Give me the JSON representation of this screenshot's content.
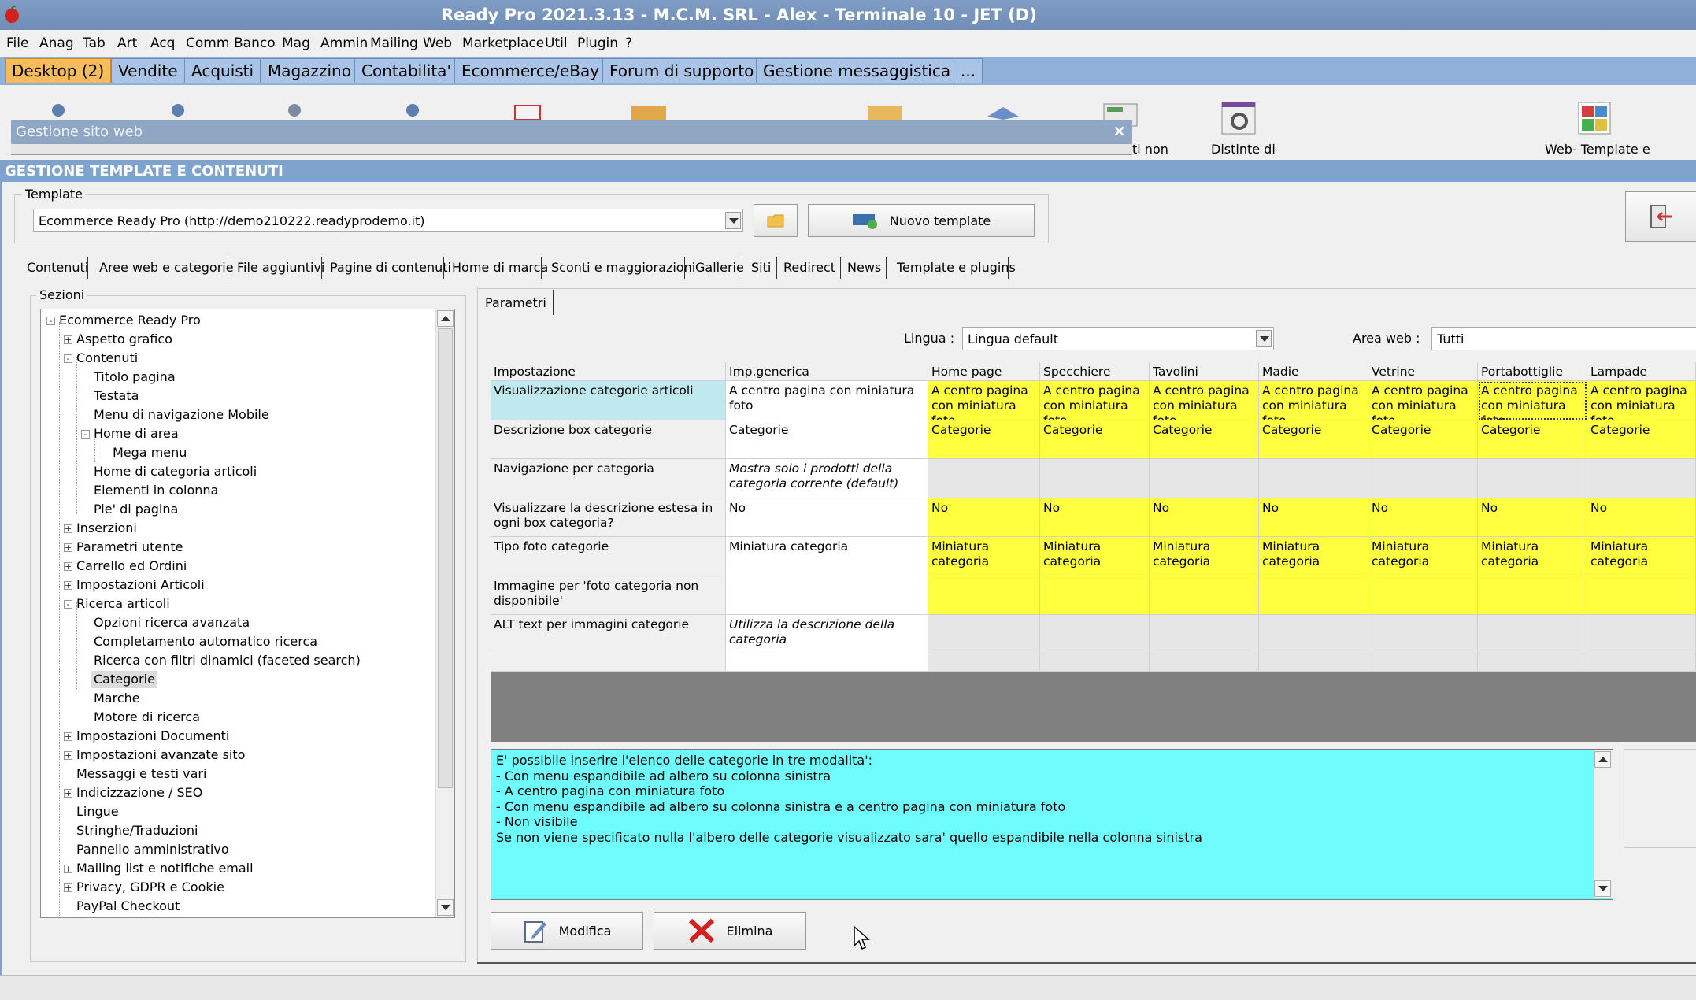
{
  "window": {
    "title": "Ready Pro 2021.3.13 - M.C.M. SRL - Alex - Terminale 10 - JET (D)"
  },
  "menubar": [
    "File",
    "Anag",
    "Tab",
    "Art",
    "Acq",
    "Comm",
    "Banco",
    "Mag",
    "Ammin",
    "Mailing",
    "Web",
    "Marketplace",
    "Util",
    "Plugin",
    "?"
  ],
  "main_tabs": [
    "Desktop (2)",
    "Vendite",
    "Acquisti",
    "Magazzino",
    "Contabilita'",
    "Ecommerce/eBay",
    "Forum di supporto",
    "Gestione messaggistica",
    "..."
  ],
  "toolbar": {
    "label_partial": "ti non",
    "label_distinte": "Distinte di",
    "label_web": "Web- Template e"
  },
  "subwindow": {
    "title": "Gestione sito web"
  },
  "panel": {
    "header": "GESTIONE TEMPLATE E CONTENUTI",
    "template_label": "Template",
    "template_value": "Ecommerce Ready Pro (http://demo210222.readyprodemo.it)",
    "new_template_button": "Nuovo template"
  },
  "content_tabs": [
    "Contenuti",
    "Aree web e categorie",
    "File aggiuntivi",
    "Pagine di contenuti",
    "Home di marca",
    "Sconti e maggiorazioni",
    "Gallerie",
    "Siti",
    "Redirect",
    "News",
    "Template e plugins"
  ],
  "sections": {
    "label": "Sezioni",
    "tree": [
      {
        "label": "Ecommerce Ready Pro",
        "level": 0,
        "toggle": "-"
      },
      {
        "label": "Aspetto grafico",
        "level": 1,
        "toggle": "+"
      },
      {
        "label": "Contenuti",
        "level": 1,
        "toggle": "-"
      },
      {
        "label": "Titolo pagina",
        "level": 2,
        "toggle": ""
      },
      {
        "label": "Testata",
        "level": 2,
        "toggle": ""
      },
      {
        "label": "Menu di navigazione Mobile",
        "level": 2,
        "toggle": ""
      },
      {
        "label": "Home di area",
        "level": 2,
        "toggle": "-"
      },
      {
        "label": "Mega menu",
        "level": 3,
        "toggle": ""
      },
      {
        "label": "Home di categoria articoli",
        "level": 2,
        "toggle": ""
      },
      {
        "label": "Elementi in colonna",
        "level": 2,
        "toggle": ""
      },
      {
        "label": "Pie' di pagina",
        "level": 2,
        "toggle": ""
      },
      {
        "label": "Inserzioni",
        "level": 1,
        "toggle": "+"
      },
      {
        "label": "Parametri utente",
        "level": 1,
        "toggle": "+"
      },
      {
        "label": "Carrello ed Ordini",
        "level": 1,
        "toggle": "+"
      },
      {
        "label": "Impostazioni Articoli",
        "level": 1,
        "toggle": "+"
      },
      {
        "label": "Ricerca articoli",
        "level": 1,
        "toggle": "-"
      },
      {
        "label": "Opzioni ricerca avanzata",
        "level": 2,
        "toggle": ""
      },
      {
        "label": "Completamento automatico ricerca",
        "level": 2,
        "toggle": ""
      },
      {
        "label": "Ricerca con filtri dinamici (faceted search)",
        "level": 2,
        "toggle": ""
      },
      {
        "label": "Categorie",
        "level": 2,
        "toggle": "",
        "selected": true
      },
      {
        "label": "Marche",
        "level": 2,
        "toggle": ""
      },
      {
        "label": "Motore di ricerca",
        "level": 2,
        "toggle": ""
      },
      {
        "label": "Impostazioni Documenti",
        "level": 1,
        "toggle": "+"
      },
      {
        "label": "Impostazioni avanzate sito",
        "level": 1,
        "toggle": "+"
      },
      {
        "label": "Messaggi e testi vari",
        "level": 1,
        "toggle": ""
      },
      {
        "label": "Indicizzazione / SEO",
        "level": 1,
        "toggle": "+"
      },
      {
        "label": "Lingue",
        "level": 1,
        "toggle": ""
      },
      {
        "label": "Stringhe/Traduzioni",
        "level": 1,
        "toggle": ""
      },
      {
        "label": "Pannello amministrativo",
        "level": 1,
        "toggle": ""
      },
      {
        "label": "Mailing list e notifiche email",
        "level": 1,
        "toggle": "+"
      },
      {
        "label": "Privacy, GDPR e Cookie",
        "level": 1,
        "toggle": "+"
      },
      {
        "label": "PayPal Checkout",
        "level": 1,
        "toggle": ""
      }
    ]
  },
  "params": {
    "tab": "Parametri",
    "lingua_label": "Lingua :",
    "lingua_value": "Lingua default",
    "area_label": "Area web :",
    "area_value": "Tutti"
  },
  "grid": {
    "columns": [
      "Impostazione",
      "Imp.generica",
      "Home page",
      "Specchiere",
      "Tavolini",
      "Madie",
      "Vetrine",
      "Portabottiglie",
      "Lampade"
    ],
    "rows": [
      {
        "setting": "Visualizzazione categorie articoli",
        "generic": "A centro pagina con miniatura foto",
        "generic_italic": false,
        "value": "A centro pagina con miniatura foto",
        "kind": "yellow"
      },
      {
        "setting": "Descrizione box categorie",
        "generic": "Categorie",
        "generic_italic": false,
        "value": "Categorie",
        "kind": "yellow"
      },
      {
        "setting": "Navigazione per categoria",
        "generic": "Mostra solo i prodotti della categoria corrente (default)",
        "generic_italic": true,
        "value": "",
        "kind": "gray"
      },
      {
        "setting": "Visualizzare la descrizione estesa in ogni box categoria?",
        "generic": "No",
        "generic_italic": false,
        "value": "No",
        "kind": "yellow"
      },
      {
        "setting": "Tipo foto categorie",
        "generic": "Miniatura categoria",
        "generic_italic": false,
        "value": "Miniatura categoria",
        "kind": "yellow"
      },
      {
        "setting": "Immagine per 'foto categoria non disponibile'",
        "generic": "",
        "generic_italic": false,
        "value": "",
        "kind": "yellow"
      },
      {
        "setting": "ALT text per immagini categorie",
        "generic": "Utilizza la descrizione della categoria",
        "generic_italic": true,
        "value": "",
        "kind": "gray"
      }
    ]
  },
  "description": [
    "E' possibile inserire l'elenco delle categorie in tre modalita':",
    "- Con menu espandibile ad albero su colonna sinistra",
    "- A centro pagina con miniatura foto",
    "- Con menu espandibile ad albero su colonna sinistra e a centro pagina con miniatura foto",
    "- Non visibile",
    "Se non viene specificato nulla l'albero delle categorie visualizzato sara' quello espandibile nella colonna sinistra"
  ],
  "actions": {
    "modifica": "Modifica",
    "elimina": "Elimina"
  },
  "colors": {
    "yellow": "#ffff40",
    "cyan": "#6ffcfc",
    "active_tab": "#f6bb5a",
    "header_blue": "#7fa3cf",
    "selected_setting": "#bfe8ef"
  }
}
